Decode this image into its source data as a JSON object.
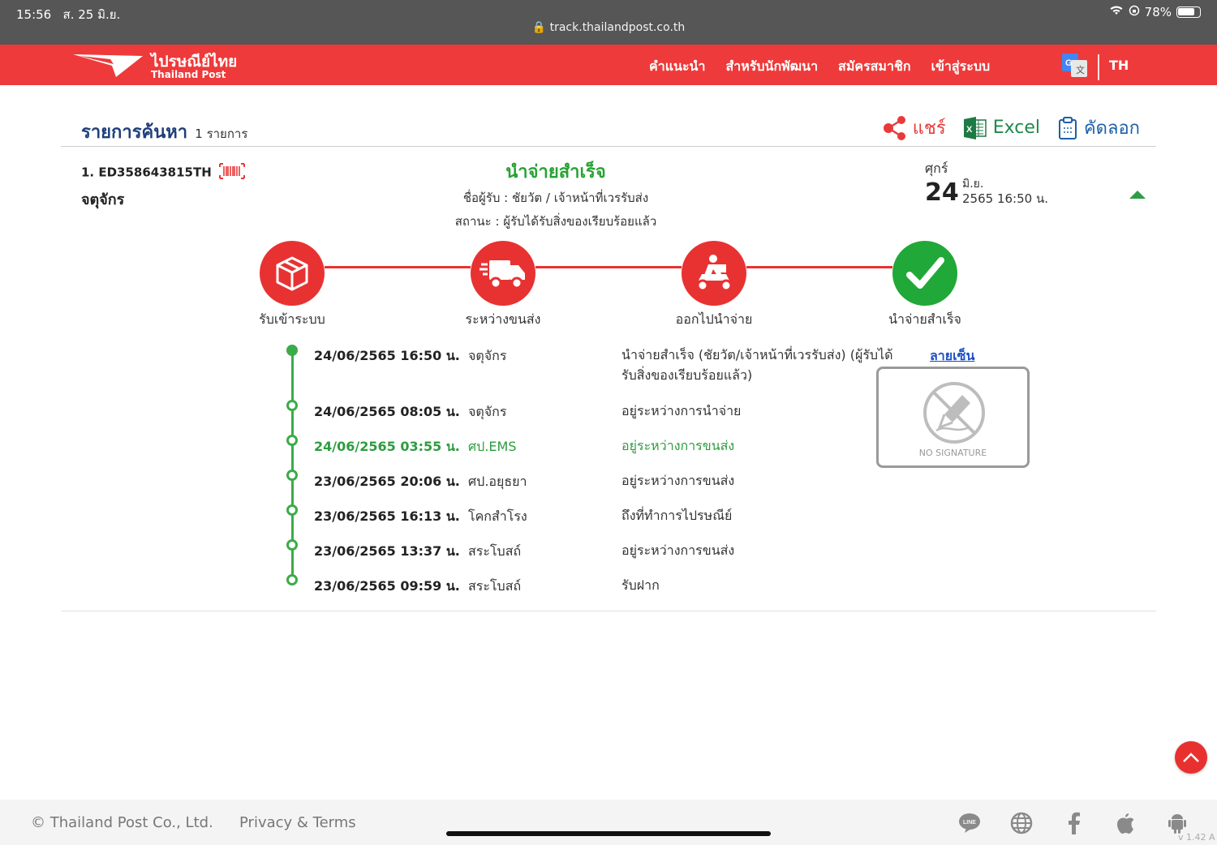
{
  "status_bar": {
    "time": "15:56",
    "date": "ส. 25 มิ.ย.",
    "battery": "78%"
  },
  "browser": {
    "url": "track.thailandpost.co.th"
  },
  "nav": {
    "logo_th": "ไปรษณีย์ไทย",
    "logo_en": "Thailand Post",
    "items": [
      "คำแนะนำ",
      "สำหรับนักพัฒนา",
      "สมัครสมาชิก",
      "เข้าสู่ระบบ"
    ],
    "lang": "TH"
  },
  "results": {
    "title": "รายการค้นหา",
    "count": "1 รายการ",
    "actions": {
      "share": "แชร์",
      "excel": "Excel",
      "copy": "คัดลอก"
    }
  },
  "item": {
    "number": "1. ED358643815TH",
    "place": "จตุจักร",
    "status_title": "นำจ่ายสำเร็จ",
    "receiver": "ชื่อผู้รับ : ชัยวัต / เจ้าหน้าที่เวรรับส่ง",
    "status_text": "สถานะ : ผู้รับได้รับสิ่งของเรียบร้อยแล้ว",
    "date": {
      "dow": "ศุกร์",
      "day": "24",
      "month": "มิ.ย.",
      "rest": "2565 16:50 น."
    }
  },
  "steps": [
    {
      "label": "รับเข้าระบบ",
      "icon": "box-icon",
      "done": false
    },
    {
      "label": "ระหว่างขนส่ง",
      "icon": "truck-icon",
      "done": false
    },
    {
      "label": "ออกไปนำจ่าย",
      "icon": "scooter-icon",
      "done": false
    },
    {
      "label": "นำจ่ายสำเร็จ",
      "icon": "check-icon",
      "done": true
    }
  ],
  "timeline": [
    {
      "date": "24/06/2565 16:50 น.",
      "place": "จตุจักร",
      "desc": "นำจ่ายสำเร็จ (ชัยวัต/เจ้าหน้าที่เวรรับส่ง) (ผู้รับได้รับสิ่งของเรียบร้อยแล้ว)"
    },
    {
      "date": "24/06/2565 08:05 น.",
      "place": "จตุจักร",
      "desc": "อยู่ระหว่างการนำจ่าย"
    },
    {
      "date": "24/06/2565 03:55 น.",
      "place": "ศป.EMS",
      "desc": "อยู่ระหว่างการขนส่ง"
    },
    {
      "date": "23/06/2565 20:06 น.",
      "place": "ศป.อยุธยา",
      "desc": "อยู่ระหว่างการขนส่ง"
    },
    {
      "date": "23/06/2565 16:13 น.",
      "place": "โคกสำโรง",
      "desc": "ถึงที่ทำการไปรษณีย์"
    },
    {
      "date": "23/06/2565 13:37 น.",
      "place": "สระโบสถ์",
      "desc": "อยู่ระหว่างการขนส่ง"
    },
    {
      "date": "23/06/2565 09:59 น.",
      "place": "สระโบสถ์",
      "desc": "รับฝาก"
    }
  ],
  "signature": {
    "link": "ลายเซ็น",
    "placeholder": "NO SIGNATURE"
  },
  "footer": {
    "copyright": "© Thailand Post Co., Ltd.",
    "privacy": "Privacy & Terms",
    "version": "v 1.42 A"
  },
  "colors": {
    "brand_red": "#ee3a3a",
    "success_green": "#26a334",
    "link_blue": "#1d4fc4"
  }
}
